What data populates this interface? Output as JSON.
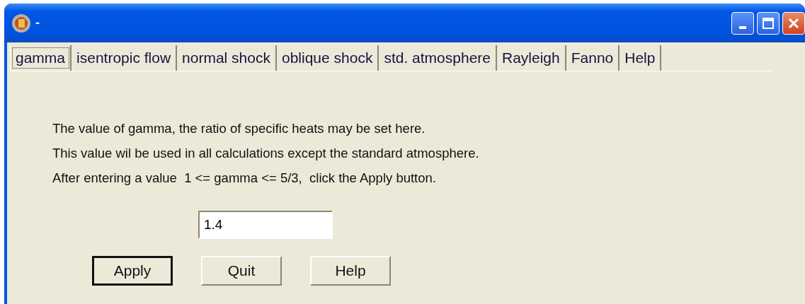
{
  "window": {
    "title": "-"
  },
  "tabs": [
    {
      "label": "gamma",
      "selected": true
    },
    {
      "label": "isentropic flow",
      "selected": false
    },
    {
      "label": "normal shock",
      "selected": false
    },
    {
      "label": "oblique shock",
      "selected": false
    },
    {
      "label": "std. atmosphere",
      "selected": false
    },
    {
      "label": "Rayleigh",
      "selected": false
    },
    {
      "label": "Fanno",
      "selected": false
    },
    {
      "label": "Help",
      "selected": false
    }
  ],
  "instructions": [
    "The value of gamma, the ratio of specific heats may be set here.",
    "This value wil be used in all calculations except the standard atmosphere.",
    "After entering a value  1 <= gamma <= 5/3,  click the Apply button."
  ],
  "gamma_field": {
    "value": "1.4"
  },
  "buttons": [
    {
      "label": "Apply",
      "default": true
    },
    {
      "label": "Quit",
      "default": false
    },
    {
      "label": "Help",
      "default": false
    }
  ]
}
